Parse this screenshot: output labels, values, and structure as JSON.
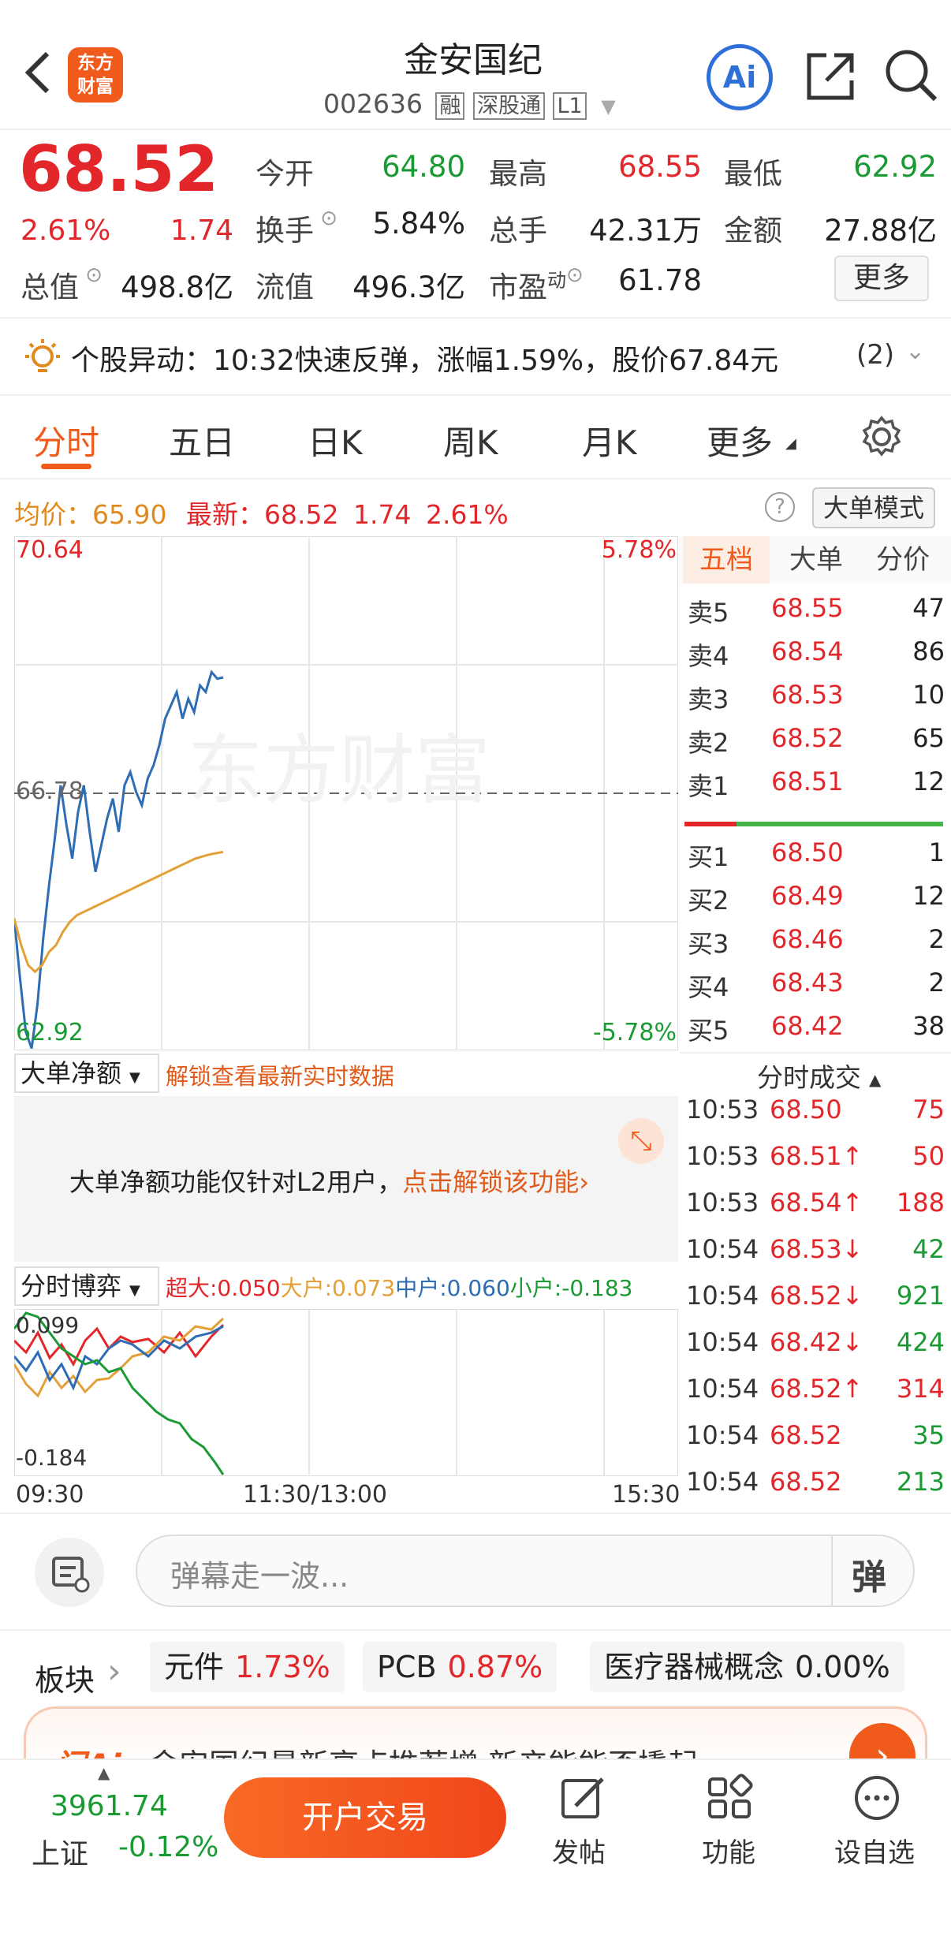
{
  "header": {
    "back_icon": "chevron-left-icon",
    "logo_text_1": "东方",
    "logo_text_2": "财富",
    "title": "金安国纪",
    "code": "002636",
    "badges": [
      "融",
      "深股通",
      "L1"
    ],
    "ai_label": "Ai"
  },
  "quote": {
    "price": "68.52",
    "change_pct": "2.61%",
    "change": "1.74",
    "open_label": "今开",
    "open": "64.80",
    "high_label": "最高",
    "high": "68.55",
    "low_label": "最低",
    "low": "62.92",
    "turnover_label": "换手",
    "turnover": "5.84%",
    "volume_label": "总手",
    "volume": "42.31万",
    "amount_label": "金额",
    "amount": "27.88亿",
    "mktcap_label": "总值",
    "mktcap": "498.8亿",
    "float_label": "流值",
    "float_cap": "496.3亿",
    "pe_label": "市盈",
    "pe_sup": "动",
    "pe": "61.78",
    "more_label": "更多"
  },
  "alert": {
    "text": "个股异动：10:32快速反弹，涨幅1.59%，股价67.84元",
    "count": "(2)"
  },
  "tabs": [
    "分时",
    "五日",
    "日K",
    "周K",
    "月K",
    "更多"
  ],
  "info_line": {
    "avg_label": "均价：",
    "avg": "65.90",
    "latest_label": "最新：",
    "latest": "68.52",
    "chg": "1.74",
    "pct": "2.61%",
    "mode_label": "大单模式"
  },
  "chart": {
    "y_top": "70.64",
    "y_mid": "66.78",
    "y_bot": "62.92",
    "pct_top": "5.78%",
    "pct_bot": "-5.78%",
    "watermark": "东方财富",
    "x_labels": [
      "09:30",
      "11:30/13:00",
      "15:30"
    ]
  },
  "chart_data": {
    "type": "line",
    "title": "",
    "ylim": [
      62.92,
      70.64
    ],
    "x_range": [
      "09:30",
      "15:00"
    ],
    "series": [
      {
        "name": "最新",
        "color": "#2e6db4",
        "values": [
          64.9,
          64.0,
          63.2,
          62.95,
          63.6,
          64.6,
          65.4,
          66.1,
          66.9,
          66.3,
          65.8,
          66.5,
          66.9,
          66.2,
          65.6,
          66.0,
          66.4,
          66.7,
          66.2,
          66.9,
          67.1,
          66.8,
          66.6,
          67.0,
          67.2,
          67.5,
          67.9,
          68.1,
          68.3,
          67.9,
          68.2,
          68.0,
          68.4,
          68.3,
          68.6,
          68.5,
          68.52
        ]
      },
      {
        "name": "均价",
        "color": "#e3a036",
        "values": [
          64.9,
          64.5,
          64.2,
          64.1,
          64.2,
          64.4,
          64.5,
          64.7,
          64.85,
          64.95,
          65.0,
          65.05,
          65.1,
          65.15,
          65.2,
          65.25,
          65.3,
          65.35,
          65.4,
          65.45,
          65.5,
          65.55,
          65.6,
          65.65,
          65.7,
          65.75,
          65.8,
          65.83,
          65.86,
          65.88,
          65.9
        ]
      }
    ]
  },
  "orderbook": {
    "tabs": [
      "五档",
      "大单",
      "分价"
    ],
    "asks": [
      {
        "l": "卖5",
        "p": "68.55",
        "q": "47"
      },
      {
        "l": "卖4",
        "p": "68.54",
        "q": "86"
      },
      {
        "l": "卖3",
        "p": "68.53",
        "q": "10"
      },
      {
        "l": "卖2",
        "p": "68.52",
        "q": "65"
      },
      {
        "l": "卖1",
        "p": "68.51",
        "q": "12"
      }
    ],
    "bids": [
      {
        "l": "买1",
        "p": "68.50",
        "q": "1"
      },
      {
        "l": "买2",
        "p": "68.49",
        "q": "12"
      },
      {
        "l": "买3",
        "p": "68.46",
        "q": "2"
      },
      {
        "l": "买4",
        "p": "68.43",
        "q": "2"
      },
      {
        "l": "买5",
        "p": "68.42",
        "q": "38"
      }
    ]
  },
  "ticks": {
    "title": "分时成交",
    "rows": [
      {
        "t": "10:53",
        "p": "68.50",
        "q": "75",
        "c": "red",
        "qc": "red"
      },
      {
        "t": "10:53",
        "p": "68.51↑",
        "q": "50",
        "c": "red",
        "qc": "red"
      },
      {
        "t": "10:53",
        "p": "68.54↑",
        "q": "188",
        "c": "red",
        "qc": "red"
      },
      {
        "t": "10:54",
        "p": "68.53↓",
        "q": "42",
        "c": "red",
        "qc": "green"
      },
      {
        "t": "10:54",
        "p": "68.52↓",
        "q": "921",
        "c": "red",
        "qc": "green"
      },
      {
        "t": "10:54",
        "p": "68.42↓",
        "q": "424",
        "c": "red",
        "qc": "green"
      },
      {
        "t": "10:54",
        "p": "68.52↑",
        "q": "314",
        "c": "red",
        "qc": "red"
      },
      {
        "t": "10:54",
        "p": "68.52",
        "q": "35",
        "c": "red",
        "qc": "green"
      },
      {
        "t": "10:54",
        "p": "68.52",
        "q": "213",
        "c": "red",
        "qc": "green"
      }
    ]
  },
  "bigorder": {
    "select_label": "大单净额",
    "unlock_link": "解锁查看最新实时数据",
    "notice": "大单净额功能仅针对L2用户，",
    "notice_link": "点击解锁该功能›"
  },
  "game": {
    "select_label": "分时博弈",
    "super": "超大:0.050",
    "big": "大户:0.073",
    "mid": "中户:0.060",
    "small": "小户:-0.183",
    "y_top": "0.099",
    "y_bot": "-0.184"
  },
  "comment": {
    "placeholder": "弹幕走一波...",
    "danmu_label": "弹"
  },
  "sectors": {
    "label": "板块",
    "items": [
      {
        "name": "元件",
        "pct": "1.73%",
        "c": "red"
      },
      {
        "name": "PCB",
        "pct": "0.87%",
        "c": "red"
      },
      {
        "name": "医疗器械概念",
        "pct": "0.00%",
        "c": "black"
      }
    ]
  },
  "banner": {
    "text": "金安国纪最新亮点推荐增 新产能能否撬起"
  },
  "bottom": {
    "index_value": "3961.74",
    "index_name": "上证",
    "index_pct": "-0.12%",
    "trade_label": "开户交易",
    "post_label": "发帖",
    "func_label": "功能",
    "watch_label": "设自选"
  },
  "colors": {
    "up": "#e2262a",
    "down": "#1a9a33",
    "accent": "#f05a1a",
    "line": "#2e6db4",
    "avg": "#e3a036"
  }
}
